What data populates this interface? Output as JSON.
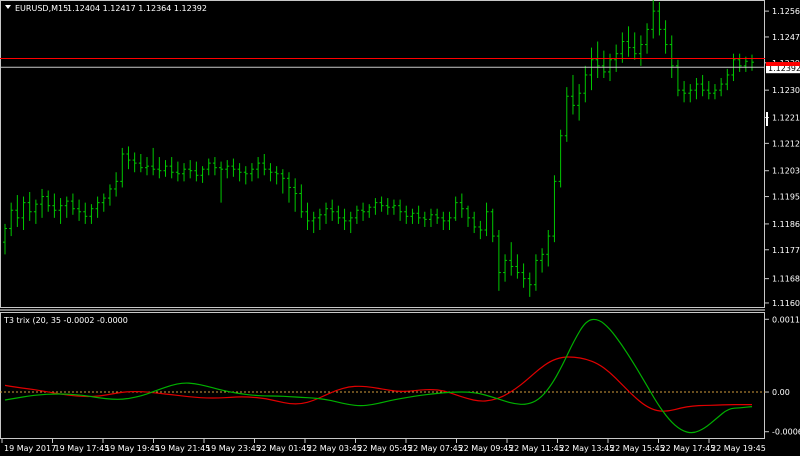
{
  "header": {
    "symbol_label": "EURUSD,M15",
    "ohlc_label": "1.12404 1.12417 1.12364 1.12392",
    "dropdown_icon": "triangle-down-icon"
  },
  "indicator": {
    "label": "T3 trix (20, 35 -0.0002 -0.0000"
  },
  "colors": {
    "background": "#000000",
    "bars": "#00c800",
    "hline": "#ff0000",
    "bid_line": "#c8c8c8",
    "trix_fast": "#00b000",
    "trix_slow": "#e00000",
    "zero_line": "#d29b3c",
    "frame": "#c8c8c8"
  },
  "chart_data": [
    {
      "type": "ohlc",
      "title": "EURUSD,M15",
      "y_ticks": [
        "1.12560",
        "1.12475",
        "1.12390",
        "1.12300",
        "1.12210",
        "1.12125",
        "1.12035",
        "1.11950",
        "1.11860",
        "1.11775",
        "1.11680",
        "1.11600"
      ],
      "ylim": [
        1.1159,
        1.1259
      ],
      "horizontal_line": 1.12404,
      "current_price": "1.12392",
      "bars": [
        {
          "o": 1.118,
          "h": 1.1186,
          "l": 1.1176,
          "c": 1.11845
        },
        {
          "o": 1.11845,
          "h": 1.1193,
          "l": 1.1182,
          "c": 1.11905
        },
        {
          "o": 1.11905,
          "h": 1.11955,
          "l": 1.1185,
          "c": 1.1188
        },
        {
          "o": 1.1188,
          "h": 1.1195,
          "l": 1.1184,
          "c": 1.1193
        },
        {
          "o": 1.1193,
          "h": 1.11965,
          "l": 1.1187,
          "c": 1.119
        },
        {
          "o": 1.119,
          "h": 1.1194,
          "l": 1.1186,
          "c": 1.11925
        },
        {
          "o": 1.11925,
          "h": 1.11975,
          "l": 1.1188,
          "c": 1.1195
        },
        {
          "o": 1.1195,
          "h": 1.1197,
          "l": 1.119,
          "c": 1.1192
        },
        {
          "o": 1.1192,
          "h": 1.1196,
          "l": 1.1188,
          "c": 1.11905
        },
        {
          "o": 1.11905,
          "h": 1.11945,
          "l": 1.1186,
          "c": 1.1192
        },
        {
          "o": 1.1192,
          "h": 1.1195,
          "l": 1.1188,
          "c": 1.11935
        },
        {
          "o": 1.11935,
          "h": 1.1196,
          "l": 1.1189,
          "c": 1.1191
        },
        {
          "o": 1.1191,
          "h": 1.1194,
          "l": 1.1187,
          "c": 1.119
        },
        {
          "o": 1.119,
          "h": 1.1193,
          "l": 1.1186,
          "c": 1.11885
        },
        {
          "o": 1.11885,
          "h": 1.11925,
          "l": 1.1186,
          "c": 1.1191
        },
        {
          "o": 1.1191,
          "h": 1.1195,
          "l": 1.1188,
          "c": 1.1193
        },
        {
          "o": 1.1193,
          "h": 1.1196,
          "l": 1.119,
          "c": 1.11945
        },
        {
          "o": 1.11945,
          "h": 1.1199,
          "l": 1.1192,
          "c": 1.11975
        },
        {
          "o": 1.11975,
          "h": 1.1203,
          "l": 1.1195,
          "c": 1.12
        },
        {
          "o": 1.12,
          "h": 1.1211,
          "l": 1.1198,
          "c": 1.1209
        },
        {
          "o": 1.1209,
          "h": 1.12115,
          "l": 1.1204,
          "c": 1.1207
        },
        {
          "o": 1.1207,
          "h": 1.12095,
          "l": 1.1203,
          "c": 1.1206
        },
        {
          "o": 1.1206,
          "h": 1.1209,
          "l": 1.1203,
          "c": 1.12045
        },
        {
          "o": 1.12045,
          "h": 1.1208,
          "l": 1.1202,
          "c": 1.1205
        },
        {
          "o": 1.1205,
          "h": 1.1211,
          "l": 1.1202,
          "c": 1.1204
        },
        {
          "o": 1.1204,
          "h": 1.1208,
          "l": 1.1201,
          "c": 1.12035
        },
        {
          "o": 1.12035,
          "h": 1.1207,
          "l": 1.12015,
          "c": 1.1205
        },
        {
          "o": 1.1205,
          "h": 1.1208,
          "l": 1.1201,
          "c": 1.1203
        },
        {
          "o": 1.1203,
          "h": 1.12065,
          "l": 1.12,
          "c": 1.12025
        },
        {
          "o": 1.12025,
          "h": 1.1206,
          "l": 1.12,
          "c": 1.1204
        },
        {
          "o": 1.1204,
          "h": 1.1207,
          "l": 1.1201,
          "c": 1.12035
        },
        {
          "o": 1.12035,
          "h": 1.12065,
          "l": 1.12,
          "c": 1.1202
        },
        {
          "o": 1.1202,
          "h": 1.1205,
          "l": 1.11995,
          "c": 1.1204
        },
        {
          "o": 1.1204,
          "h": 1.12075,
          "l": 1.1202,
          "c": 1.1206
        },
        {
          "o": 1.1206,
          "h": 1.1208,
          "l": 1.1202,
          "c": 1.12045
        },
        {
          "o": 1.12045,
          "h": 1.12065,
          "l": 1.1193,
          "c": 1.1204
        },
        {
          "o": 1.1204,
          "h": 1.1207,
          "l": 1.1201,
          "c": 1.1205
        },
        {
          "o": 1.1205,
          "h": 1.12075,
          "l": 1.12015,
          "c": 1.1204
        },
        {
          "o": 1.1204,
          "h": 1.1206,
          "l": 1.12,
          "c": 1.1203
        },
        {
          "o": 1.1203,
          "h": 1.1205,
          "l": 1.1199,
          "c": 1.12025
        },
        {
          "o": 1.12025,
          "h": 1.1206,
          "l": 1.12,
          "c": 1.1204
        },
        {
          "o": 1.1204,
          "h": 1.1208,
          "l": 1.1201,
          "c": 1.1206
        },
        {
          "o": 1.1206,
          "h": 1.1209,
          "l": 1.1202,
          "c": 1.1204
        },
        {
          "o": 1.1204,
          "h": 1.1206,
          "l": 1.12,
          "c": 1.1203
        },
        {
          "o": 1.1203,
          "h": 1.1205,
          "l": 1.1199,
          "c": 1.12025
        },
        {
          "o": 1.12025,
          "h": 1.1204,
          "l": 1.1196,
          "c": 1.1201
        },
        {
          "o": 1.1201,
          "h": 1.1203,
          "l": 1.1193,
          "c": 1.1198
        },
        {
          "o": 1.1198,
          "h": 1.1201,
          "l": 1.119,
          "c": 1.1196
        },
        {
          "o": 1.1196,
          "h": 1.1199,
          "l": 1.1188,
          "c": 1.119
        },
        {
          "o": 1.119,
          "h": 1.1193,
          "l": 1.1184,
          "c": 1.1187
        },
        {
          "o": 1.1187,
          "h": 1.119,
          "l": 1.1183,
          "c": 1.1188
        },
        {
          "o": 1.1188,
          "h": 1.1191,
          "l": 1.1184,
          "c": 1.1189
        },
        {
          "o": 1.1189,
          "h": 1.1193,
          "l": 1.1186,
          "c": 1.1191
        },
        {
          "o": 1.1191,
          "h": 1.1194,
          "l": 1.1187,
          "c": 1.119
        },
        {
          "o": 1.119,
          "h": 1.1192,
          "l": 1.1186,
          "c": 1.1188
        },
        {
          "o": 1.1188,
          "h": 1.1191,
          "l": 1.1184,
          "c": 1.1187
        },
        {
          "o": 1.1187,
          "h": 1.119,
          "l": 1.1183,
          "c": 1.1188
        },
        {
          "o": 1.1188,
          "h": 1.1192,
          "l": 1.1186,
          "c": 1.11905
        },
        {
          "o": 1.11905,
          "h": 1.1193,
          "l": 1.1187,
          "c": 1.119
        },
        {
          "o": 1.119,
          "h": 1.11925,
          "l": 1.1188,
          "c": 1.11915
        },
        {
          "o": 1.11915,
          "h": 1.11945,
          "l": 1.1189,
          "c": 1.1193
        },
        {
          "o": 1.1193,
          "h": 1.1195,
          "l": 1.119,
          "c": 1.1192
        },
        {
          "o": 1.1192,
          "h": 1.11945,
          "l": 1.1189,
          "c": 1.11915
        },
        {
          "o": 1.11915,
          "h": 1.1194,
          "l": 1.1189,
          "c": 1.1192
        },
        {
          "o": 1.1192,
          "h": 1.1194,
          "l": 1.1187,
          "c": 1.119
        },
        {
          "o": 1.119,
          "h": 1.1192,
          "l": 1.1186,
          "c": 1.11885
        },
        {
          "o": 1.11885,
          "h": 1.1191,
          "l": 1.1186,
          "c": 1.11895
        },
        {
          "o": 1.11895,
          "h": 1.1192,
          "l": 1.1186,
          "c": 1.1188
        },
        {
          "o": 1.1188,
          "h": 1.119,
          "l": 1.1185,
          "c": 1.11875
        },
        {
          "o": 1.11875,
          "h": 1.1191,
          "l": 1.1185,
          "c": 1.1189
        },
        {
          "o": 1.1189,
          "h": 1.1191,
          "l": 1.1186,
          "c": 1.1188
        },
        {
          "o": 1.1188,
          "h": 1.119,
          "l": 1.1184,
          "c": 1.1187
        },
        {
          "o": 1.1187,
          "h": 1.119,
          "l": 1.1184,
          "c": 1.1188
        },
        {
          "o": 1.1188,
          "h": 1.1195,
          "l": 1.1187,
          "c": 1.1193
        },
        {
          "o": 1.1193,
          "h": 1.1196,
          "l": 1.1188,
          "c": 1.1191
        },
        {
          "o": 1.1191,
          "h": 1.1192,
          "l": 1.1185,
          "c": 1.1188
        },
        {
          "o": 1.1188,
          "h": 1.119,
          "l": 1.1183,
          "c": 1.1185
        },
        {
          "o": 1.1185,
          "h": 1.1187,
          "l": 1.1181,
          "c": 1.1184
        },
        {
          "o": 1.1184,
          "h": 1.1193,
          "l": 1.1182,
          "c": 1.119
        },
        {
          "o": 1.119,
          "h": 1.1191,
          "l": 1.118,
          "c": 1.1182
        },
        {
          "o": 1.1182,
          "h": 1.1184,
          "l": 1.1164,
          "c": 1.117
        },
        {
          "o": 1.117,
          "h": 1.1176,
          "l": 1.1167,
          "c": 1.1174
        },
        {
          "o": 1.1174,
          "h": 1.118,
          "l": 1.1169,
          "c": 1.1172
        },
        {
          "o": 1.1172,
          "h": 1.1176,
          "l": 1.1168,
          "c": 1.117
        },
        {
          "o": 1.117,
          "h": 1.1173,
          "l": 1.1165,
          "c": 1.1168
        },
        {
          "o": 1.1168,
          "h": 1.117,
          "l": 1.1162,
          "c": 1.1166
        },
        {
          "o": 1.1166,
          "h": 1.1176,
          "l": 1.1164,
          "c": 1.1174
        },
        {
          "o": 1.1174,
          "h": 1.1178,
          "l": 1.117,
          "c": 1.1176
        },
        {
          "o": 1.1176,
          "h": 1.1184,
          "l": 1.1172,
          "c": 1.1182
        },
        {
          "o": 1.1182,
          "h": 1.1202,
          "l": 1.118,
          "c": 1.12
        },
        {
          "o": 1.12,
          "h": 1.1217,
          "l": 1.1198,
          "c": 1.1215
        },
        {
          "o": 1.1215,
          "h": 1.1231,
          "l": 1.1213,
          "c": 1.1228
        },
        {
          "o": 1.1228,
          "h": 1.1235,
          "l": 1.1222,
          "c": 1.1225
        },
        {
          "o": 1.1225,
          "h": 1.1232,
          "l": 1.122,
          "c": 1.1229
        },
        {
          "o": 1.1229,
          "h": 1.1238,
          "l": 1.1226,
          "c": 1.1235
        },
        {
          "o": 1.1235,
          "h": 1.1244,
          "l": 1.123,
          "c": 1.124
        },
        {
          "o": 1.124,
          "h": 1.1246,
          "l": 1.1234,
          "c": 1.1238
        },
        {
          "o": 1.1238,
          "h": 1.1243,
          "l": 1.1234,
          "c": 1.1236
        },
        {
          "o": 1.1236,
          "h": 1.1242,
          "l": 1.1233,
          "c": 1.124
        },
        {
          "o": 1.124,
          "h": 1.1245,
          "l": 1.1236,
          "c": 1.1242
        },
        {
          "o": 1.1242,
          "h": 1.1249,
          "l": 1.1239,
          "c": 1.1246
        },
        {
          "o": 1.1246,
          "h": 1.1251,
          "l": 1.1241,
          "c": 1.1244
        },
        {
          "o": 1.1244,
          "h": 1.1249,
          "l": 1.124,
          "c": 1.1242
        },
        {
          "o": 1.1242,
          "h": 1.1248,
          "l": 1.1238,
          "c": 1.1245
        },
        {
          "o": 1.1245,
          "h": 1.1252,
          "l": 1.1242,
          "c": 1.125
        },
        {
          "o": 1.125,
          "h": 1.126,
          "l": 1.1247,
          "c": 1.1256
        },
        {
          "o": 1.1256,
          "h": 1.1259,
          "l": 1.1248,
          "c": 1.125
        },
        {
          "o": 1.125,
          "h": 1.1253,
          "l": 1.1242,
          "c": 1.1245
        },
        {
          "o": 1.1245,
          "h": 1.1248,
          "l": 1.1234,
          "c": 1.1238
        },
        {
          "o": 1.1238,
          "h": 1.124,
          "l": 1.1228,
          "c": 1.123
        },
        {
          "o": 1.123,
          "h": 1.1233,
          "l": 1.1226,
          "c": 1.1229
        },
        {
          "o": 1.1229,
          "h": 1.1232,
          "l": 1.1226,
          "c": 1.123
        },
        {
          "o": 1.123,
          "h": 1.1234,
          "l": 1.1227,
          "c": 1.1232
        },
        {
          "o": 1.1232,
          "h": 1.1235,
          "l": 1.1228,
          "c": 1.123
        },
        {
          "o": 1.123,
          "h": 1.1233,
          "l": 1.1227,
          "c": 1.1229
        },
        {
          "o": 1.1229,
          "h": 1.1232,
          "l": 1.1227,
          "c": 1.123
        },
        {
          "o": 1.123,
          "h": 1.1234,
          "l": 1.1228,
          "c": 1.1232
        },
        {
          "o": 1.1232,
          "h": 1.1237,
          "l": 1.123,
          "c": 1.1235
        },
        {
          "o": 1.1235,
          "h": 1.1242,
          "l": 1.1233,
          "c": 1.124
        },
        {
          "o": 1.124,
          "h": 1.1242,
          "l": 1.1236,
          "c": 1.1238
        },
        {
          "o": 1.1238,
          "h": 1.1241,
          "l": 1.1236,
          "c": 1.12395
        },
        {
          "o": 1.12404,
          "h": 1.12417,
          "l": 1.12364,
          "c": 1.12392
        }
      ]
    },
    {
      "type": "line",
      "title": "T3 trix (20, 35 -0.0002 -0.0000",
      "y_ticks": [
        "0.0011",
        "0.00",
        "-0.0006"
      ],
      "ylim": [
        -0.00068,
        0.00118
      ],
      "zero_line": 0,
      "series": [
        {
          "values": [
            -0.00012,
            -9e-05,
            -6e-05,
            -4e-05,
            -3e-05,
            -3e-05,
            -4e-05,
            -6e-05,
            -9e-05,
            -0.00011,
            -0.00011,
            -8e-05,
            -3e-05,
            4e-05,
            0.0001,
            0.00014,
            0.00013,
            9e-05,
            4e-05,
            0.0,
            -3e-05,
            -5e-05,
            -6e-05,
            -6e-05,
            -7e-05,
            -8e-05,
            -9e-05,
            -0.00011,
            -0.00015,
            -0.00019,
            -0.00021,
            -0.00019,
            -0.00015,
            -0.00011,
            -8e-05,
            -5e-05,
            -3e-05,
            -1e-05,
            0.0,
            0.0,
            -2e-05,
            -7e-05,
            -0.00013,
            -0.00018,
            -0.00019,
            -0.00012,
            8e-05,
            0.0004,
            0.00078,
            0.00108,
            0.00111,
            0.00096,
            0.00072,
            0.00044,
            0.00014,
            -0.00017,
            -0.00042,
            -0.00058,
            -0.00063,
            -0.00055,
            -0.0004,
            -0.00025,
            -0.00024,
            -0.00022
          ]
        },
        {
          "values": [
            0.0001,
            7e-05,
            5e-05,
            2e-05,
            -1e-05,
            -4e-05,
            -6e-05,
            -7e-05,
            -6e-05,
            -3e-05,
            0.0,
            1e-05,
            0.0,
            -2e-05,
            -4e-05,
            -6e-05,
            -8e-05,
            -9e-05,
            -9e-05,
            -8e-05,
            -7e-05,
            -8e-05,
            -0.0001,
            -0.00014,
            -0.00018,
            -0.00018,
            -0.00013,
            -5e-05,
            3e-05,
            8e-05,
            9e-05,
            7e-05,
            4e-05,
            1e-05,
            1e-05,
            3e-05,
            4e-05,
            2e-05,
            -4e-05,
            -0.0001,
            -0.00014,
            -0.00013,
            -7e-05,
            4e-05,
            0.00018,
            0.00034,
            0.00047,
            0.00053,
            0.00053,
            0.0005,
            0.00043,
            0.0003,
            0.00012,
            -6e-05,
            -0.00021,
            -0.00029,
            -0.00029,
            -0.00024,
            -0.00021,
            -0.0002,
            -0.0002,
            -0.00019,
            -0.00019,
            -0.00019
          ]
        }
      ]
    }
  ],
  "x_axis": {
    "tick_labels": [
      "19 May 2017",
      "19 May 17:45",
      "19 May 19:45",
      "19 May 21:45",
      "19 May 23:45",
      "22 May 01:45",
      "22 May 03:45",
      "22 May 05:45",
      "22 May 07:45",
      "22 May 09:45",
      "22 May 11:45",
      "22 May 13:45",
      "22 May 15:45",
      "22 May 17:45",
      "22 May 19:45"
    ]
  }
}
